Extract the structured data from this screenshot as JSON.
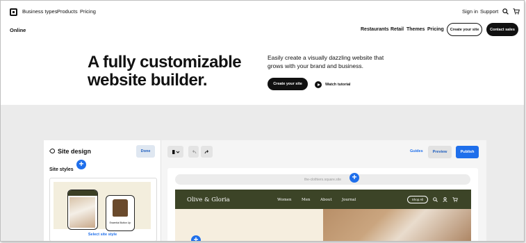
{
  "topnav": {
    "links": [
      "Business types",
      "Products",
      "Pricing"
    ],
    "right": [
      "Sign in",
      "Support"
    ],
    "icons": [
      "search-icon",
      "cart-icon"
    ]
  },
  "subnav": {
    "brand": "Online",
    "links": [
      "Restaurants",
      "Retail",
      "Themes",
      "Pricing"
    ],
    "create_site": "Create your site",
    "contact_sales": "Contact sales"
  },
  "hero": {
    "title": "A fully customizable\nwebsite builder.",
    "subtitle": "Easily create a visually dazzling website that grows with your brand and business.",
    "cta": "Create your site",
    "watch": "Watch tutorial"
  },
  "editor": {
    "panel_title": "Site design",
    "done": "Done",
    "site_styles": "Site styles",
    "select_style": "Select site style",
    "product_caption": "Essential Button Up",
    "guides": "Guides",
    "preview": "Preview",
    "publish": "Publish",
    "url": "the-clothiers.square.site",
    "site": {
      "brand": "Olive & Gloria",
      "links": [
        "Women",
        "Men",
        "About",
        "Journal"
      ],
      "shop_all": "Shop All"
    }
  },
  "colors": {
    "accent": "#1f6feb",
    "site_header": "#3c4427",
    "dark": "#111111"
  }
}
